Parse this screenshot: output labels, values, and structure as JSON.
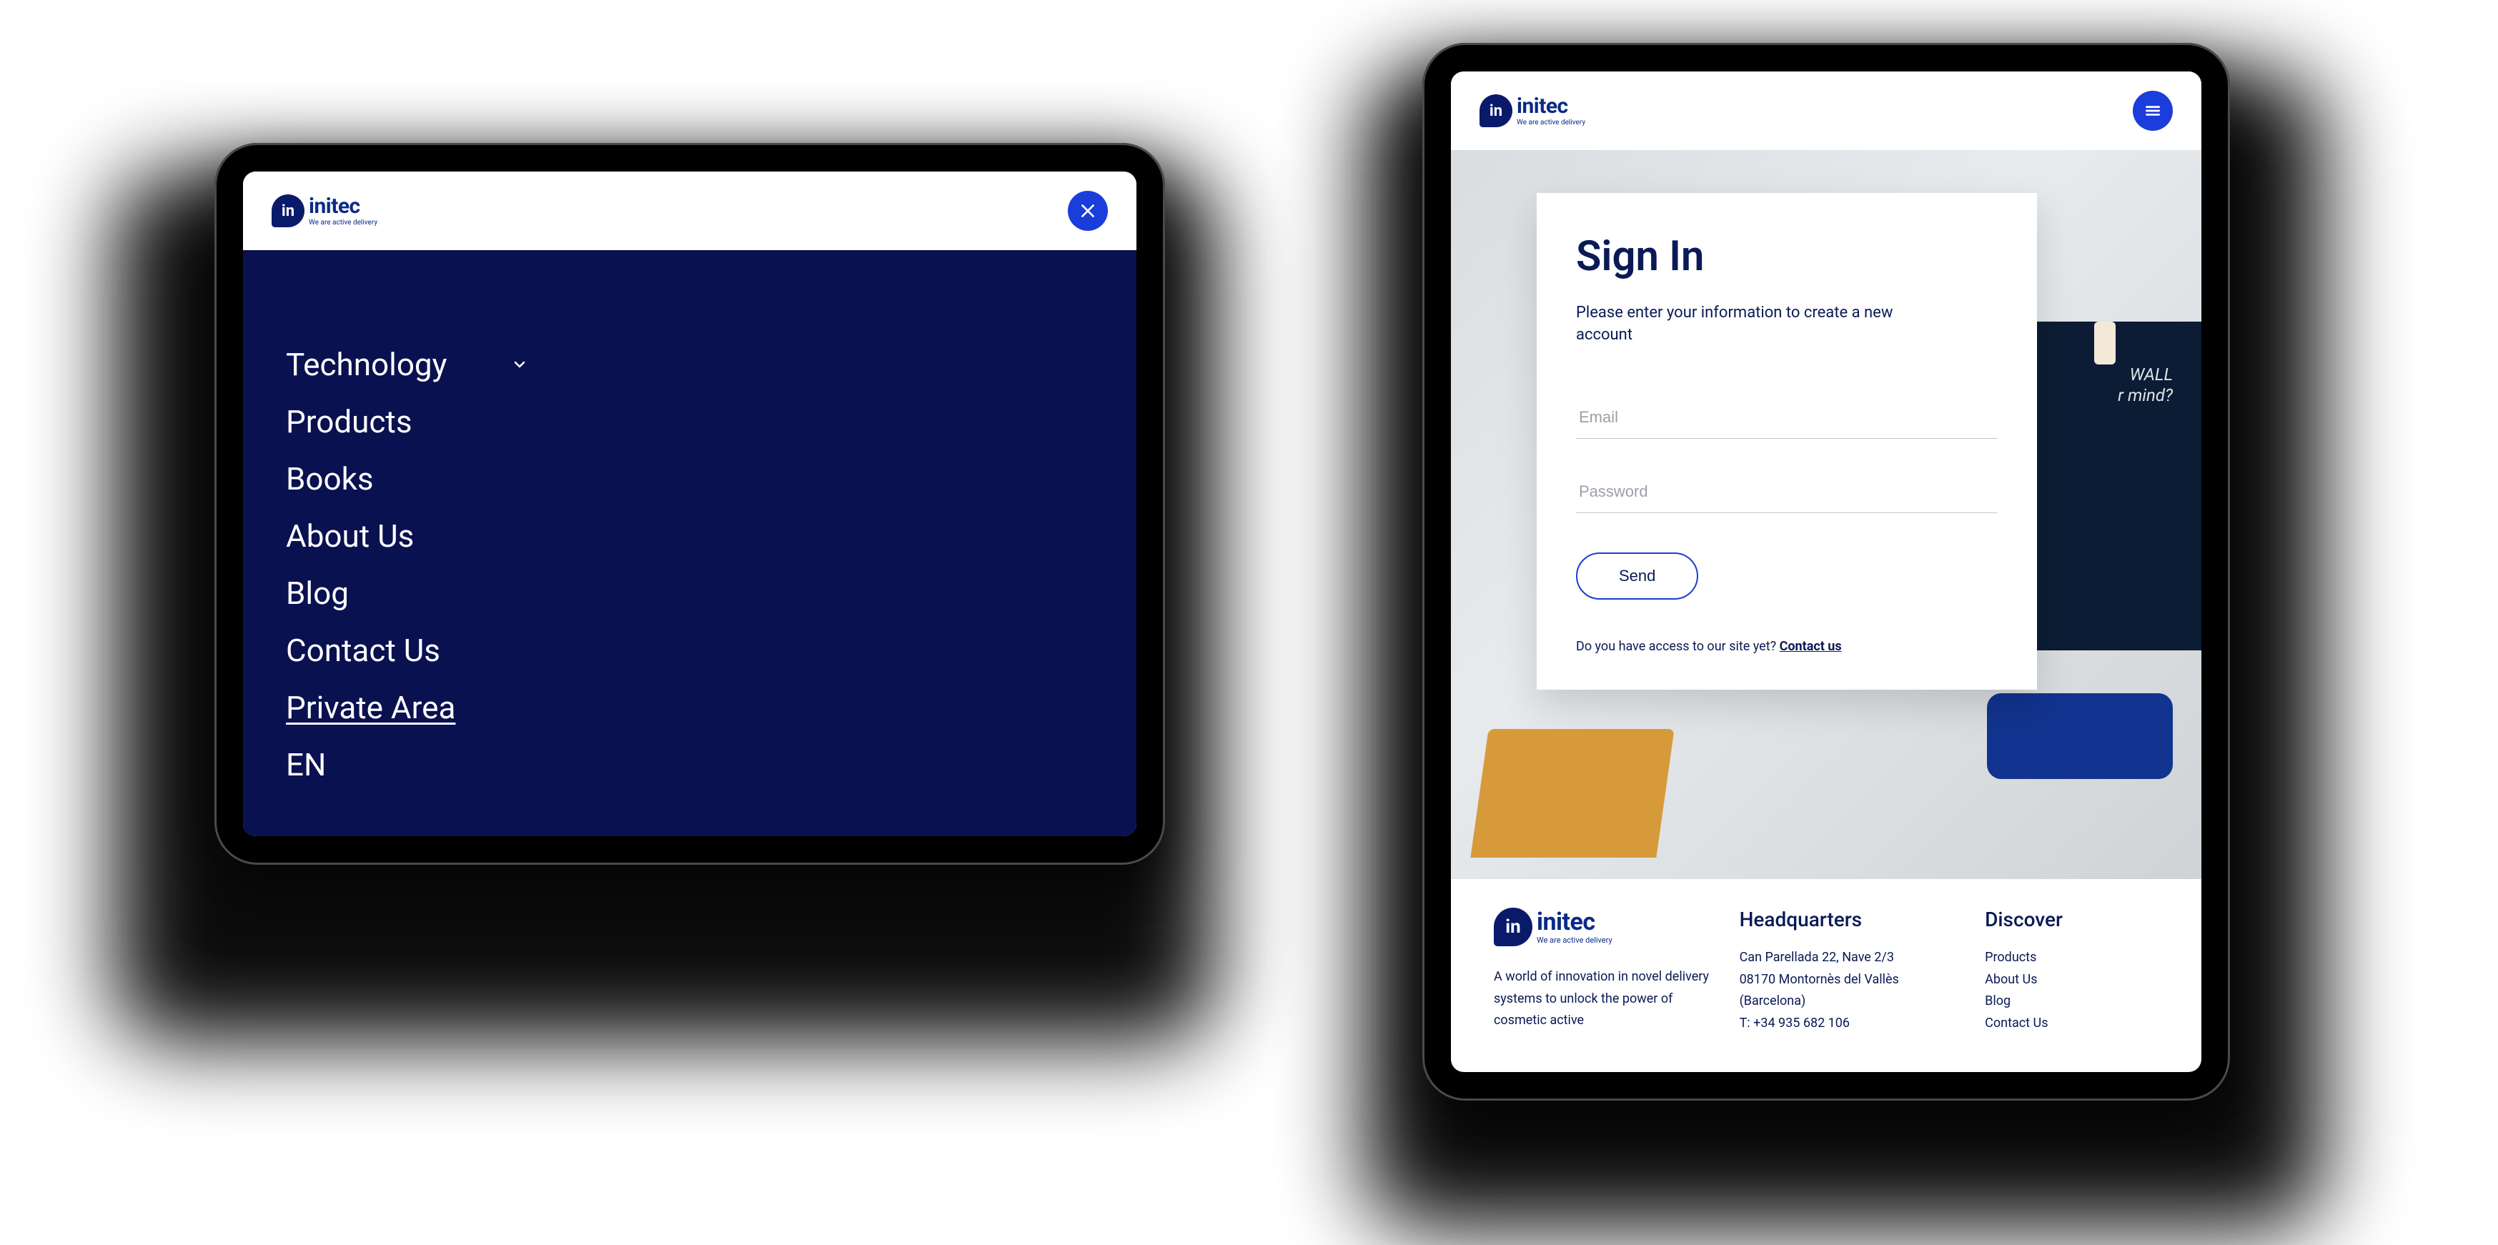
{
  "brand": {
    "mark": "in",
    "word": "initec",
    "tagline": "We are active delivery"
  },
  "left_tablet": {
    "menu": [
      {
        "label": "Technology",
        "has_submenu": true
      },
      {
        "label": "Products"
      },
      {
        "label": "Books"
      },
      {
        "label": "About Us"
      },
      {
        "label": "Blog"
      },
      {
        "label": "Contact Us"
      },
      {
        "label": "Private Area",
        "highlight": true
      },
      {
        "label": "EN"
      }
    ]
  },
  "right_tablet": {
    "wall_text_1": "WALL",
    "wall_text_2": "r mind?",
    "signin": {
      "title": "Sign In",
      "subtitle": "Please enter your information to create a new account",
      "email_placeholder": "Email",
      "password_placeholder": "Password",
      "send_label": "Send",
      "access_q": "Do you have access to our site yet? ",
      "access_link": "Contact us"
    },
    "footer": {
      "about_text": "A world of innovation in novel delivery systems to unlock the power of cosmetic active",
      "hq_heading": "Headquarters",
      "hq_line1": "Can Parellada 22, Nave 2/3",
      "hq_line2": "08170 Montornès del Vallès",
      "hq_line3": "(Barcelona)",
      "hq_line4": "T: +34 935 682 106",
      "disc_heading": "Discover",
      "disc_links": [
        "Products",
        "About Us",
        "Blog",
        "Contact Us"
      ]
    }
  }
}
